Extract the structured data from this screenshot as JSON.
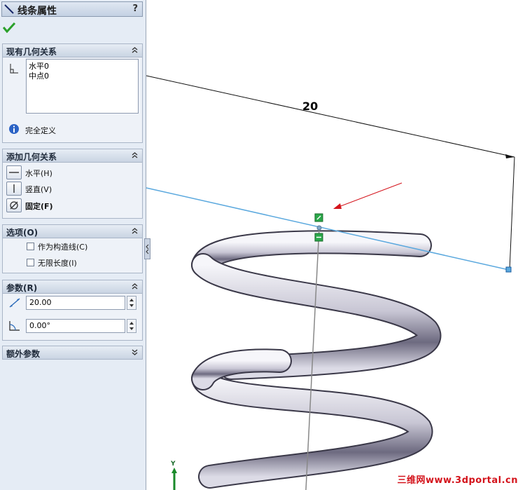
{
  "panel": {
    "title": "线条属性",
    "help": "?",
    "ok_icon": "green-checkmark-icon",
    "existing_relations": {
      "header": "现有几何关系",
      "items": [
        "水平0",
        "中点0"
      ],
      "status": "完全定义"
    },
    "add_relations": {
      "header": "添加几何关系",
      "horizontal": "水平(H)",
      "vertical": "竖直(V)",
      "fix": "固定(F)"
    },
    "options": {
      "header": "选项(O)",
      "construction": "作为构造线(C)",
      "infinite": "无限长度(I)"
    },
    "parameters": {
      "header": "参数(R)",
      "length": "20.00",
      "angle": "0.00°"
    },
    "extra": {
      "header": "额外参数"
    }
  },
  "viewport": {
    "dimension": "20",
    "triad_label": "Y",
    "watermark": "三维网www.3dportal.cn"
  },
  "colors": {
    "panel_bg": "#e5ecf5",
    "sketch_line": "#5aa8de",
    "arrow": "#d4141c",
    "endpoint": "#2aa84a"
  }
}
